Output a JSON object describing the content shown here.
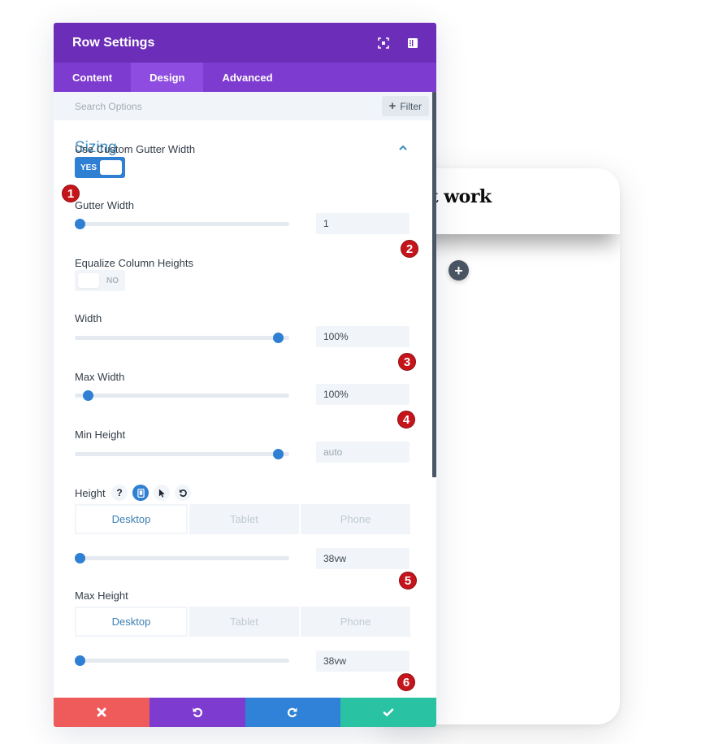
{
  "preview": {
    "title_fragment": "est work",
    "add_label": "+"
  },
  "panel": {
    "title": "Row Settings",
    "header_icons": [
      "expand-icon",
      "sidebar-toggle-icon"
    ],
    "tabs": [
      {
        "label": "Content",
        "active": false
      },
      {
        "label": "Design",
        "active": true
      },
      {
        "label": "Advanced",
        "active": false
      }
    ],
    "search": {
      "placeholder": "Search Options",
      "value": ""
    },
    "filter_label": "Filter",
    "filter_icon": "+",
    "section_title": "Sizing",
    "fields": {
      "custom_gutter": {
        "label": "Use Custom Gutter Width",
        "state": "YES"
      },
      "gutter_width": {
        "label": "Gutter Width",
        "value": "1",
        "slider_fraction": 0.0
      },
      "equalize": {
        "label": "Equalize Column Heights",
        "state": "NO"
      },
      "width": {
        "label": "Width",
        "value": "100%",
        "slider_fraction": 0.97
      },
      "max_width": {
        "label": "Max Width",
        "value": "100%",
        "slider_fraction": 0.04
      },
      "min_height": {
        "label": "Min Height",
        "value": "auto",
        "slider_fraction": 0.97
      },
      "height": {
        "label": "Height",
        "icons": [
          "?",
          "phone",
          "cursor",
          "reset"
        ],
        "devices": [
          "Desktop",
          "Tablet",
          "Phone"
        ],
        "active_device": "Desktop",
        "value": "38vw",
        "slider_fraction": 0.0
      },
      "max_height": {
        "label": "Max Height",
        "devices": [
          "Desktop",
          "Tablet",
          "Phone"
        ],
        "active_device": "Desktop",
        "value": "38vw",
        "slider_fraction": 0.0
      }
    },
    "badges": [
      "1",
      "2",
      "3",
      "4",
      "5",
      "6"
    ],
    "footer": [
      {
        "name": "cancel",
        "color": "#ef5a5a"
      },
      {
        "name": "undo",
        "color": "#7e3bd0"
      },
      {
        "name": "redo",
        "color": "#2f82d7"
      },
      {
        "name": "save",
        "color": "#29c2a2"
      }
    ]
  },
  "colors": {
    "header": "#6c2eb9",
    "tabs": "#7d3bcf",
    "tab_active": "#8e4de0",
    "accent_blue": "#2f7fd3",
    "badge_red": "#c5151b"
  }
}
